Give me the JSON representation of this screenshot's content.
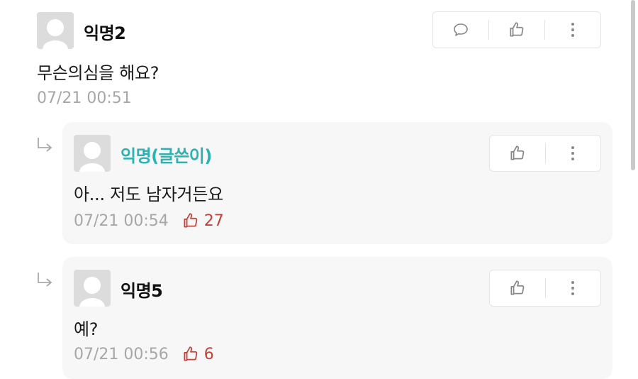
{
  "comments": [
    {
      "name": "익명2",
      "text": "무슨의심을 해요?",
      "time": "07/21 00:51"
    },
    {
      "name": "익명(글쓴이)",
      "text": "아... 저도 남자거든요",
      "time": "07/21 00:54",
      "likes": "27"
    },
    {
      "name": "익명5",
      "text": "예?",
      "time": "07/21 00:56",
      "likes": "6"
    }
  ],
  "icons": {
    "reply": "speech-bubble-icon",
    "like": "thumbs-up-icon",
    "more": "more-vertical-icon",
    "reply_indicator": "reply-arrow-icon"
  },
  "colors": {
    "author_name": "#2bb2b2",
    "likes": "#c4413a",
    "meta": "#a7a7a7",
    "reply_bg": "#f7f7f7"
  }
}
